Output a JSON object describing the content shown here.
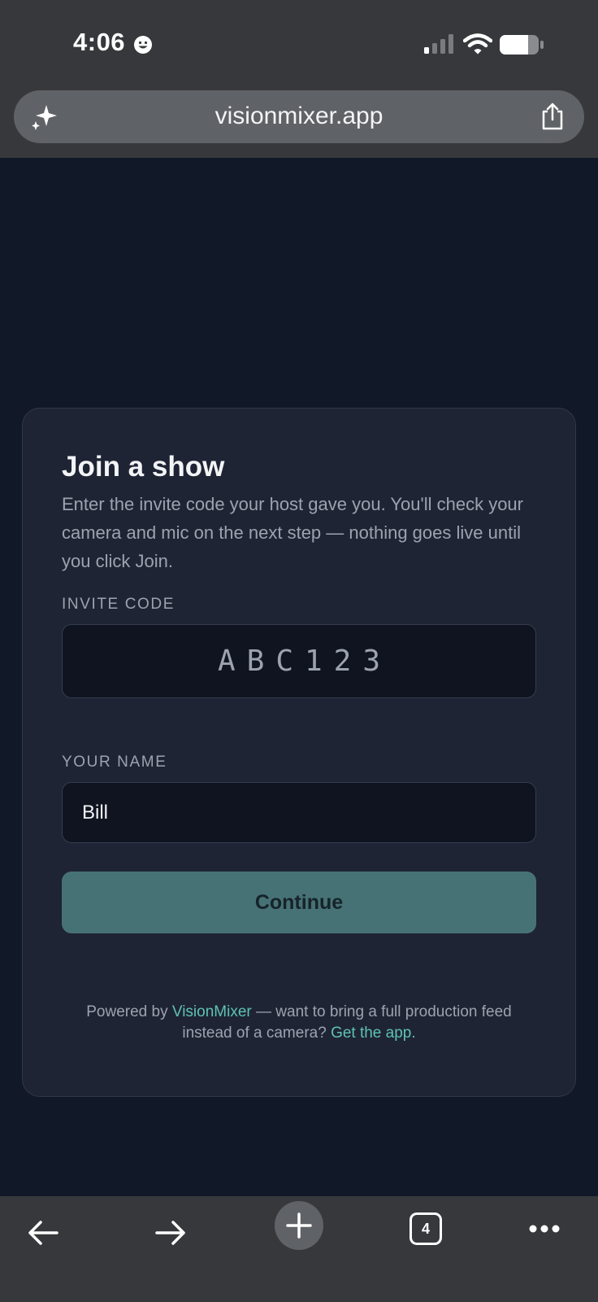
{
  "status_bar": {
    "time": "4:06"
  },
  "browser": {
    "url": "visionmixer.app",
    "tab_count": "4"
  },
  "card": {
    "title": "Join a show",
    "description": "Enter the invite code your host gave you. You'll check your camera and mic on the next step — nothing goes live until you click Join.",
    "invite_code_label": "INVITE CODE",
    "invite_code_value": "ABC123",
    "name_label": "YOUR NAME",
    "name_value": "Bill",
    "continue_label": "Continue",
    "footer": {
      "prefix": "Powered by ",
      "brand_link": "VisionMixer",
      "middle": " — want to bring a full production feed instead of a camera? ",
      "app_link": "Get the app."
    }
  },
  "colors": {
    "page_bg": "#111827",
    "card_bg": "#1e2434",
    "accent_button": "#477275",
    "link": "#5fc2b2"
  }
}
